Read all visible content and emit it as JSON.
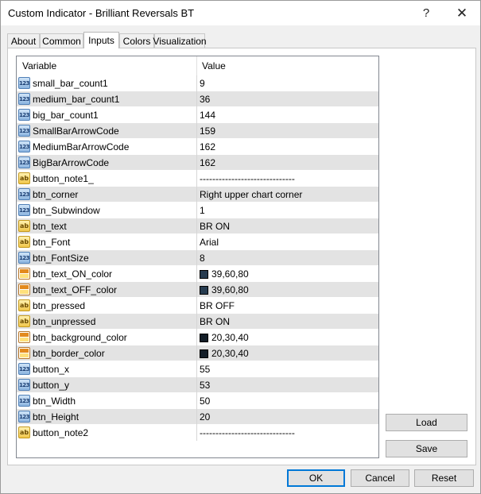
{
  "window": {
    "title": "Custom Indicator - Brilliant Reversals BT",
    "help": "?",
    "close": "✕"
  },
  "tabs": [
    {
      "label": "About"
    },
    {
      "label": "Common"
    },
    {
      "label": "Inputs"
    },
    {
      "label": "Colors"
    },
    {
      "label": "Visualization"
    }
  ],
  "active_tab": "Inputs",
  "grid": {
    "headers": {
      "variable": "Variable",
      "value": "Value"
    },
    "type_icon_labels": {
      "int": "123",
      "str": "ab"
    },
    "rows": [
      {
        "name": "small_bar_count1",
        "type": "int",
        "value": "9"
      },
      {
        "name": "medium_bar_count1",
        "type": "int",
        "value": "36"
      },
      {
        "name": "big_bar_count1",
        "type": "int",
        "value": "144"
      },
      {
        "name": "SmallBarArrowCode",
        "type": "int",
        "value": "159"
      },
      {
        "name": "MediumBarArrowCode",
        "type": "int",
        "value": "162"
      },
      {
        "name": "BigBarArrowCode",
        "type": "int",
        "value": "162"
      },
      {
        "name": "button_note1_",
        "type": "str",
        "value": "------------------------------"
      },
      {
        "name": "btn_corner",
        "type": "int",
        "value": "Right upper chart corner"
      },
      {
        "name": "btn_Subwindow",
        "type": "int",
        "value": "1"
      },
      {
        "name": "btn_text",
        "type": "str",
        "value": "BR ON"
      },
      {
        "name": "btn_Font",
        "type": "str",
        "value": "Arial"
      },
      {
        "name": "btn_FontSize",
        "type": "int",
        "value": "8"
      },
      {
        "name": "btn_text_ON_color",
        "type": "color",
        "value": "39,60,80",
        "swatch": "#273c50"
      },
      {
        "name": "btn_text_OFF_color",
        "type": "color",
        "value": "39,60,80",
        "swatch": "#273c50"
      },
      {
        "name": "btn_pressed",
        "type": "str",
        "value": "BR OFF"
      },
      {
        "name": "btn_unpressed",
        "type": "str",
        "value": "BR ON"
      },
      {
        "name": "btn_background_color",
        "type": "color",
        "value": "20,30,40",
        "swatch": "#141e28"
      },
      {
        "name": "btn_border_color",
        "type": "color",
        "value": "20,30,40",
        "swatch": "#141e28"
      },
      {
        "name": "button_x",
        "type": "int",
        "value": "55"
      },
      {
        "name": "button_y",
        "type": "int",
        "value": "53"
      },
      {
        "name": "btn_Width",
        "type": "int",
        "value": "50"
      },
      {
        "name": "btn_Height",
        "type": "int",
        "value": "20"
      },
      {
        "name": "button_note2",
        "type": "str",
        "value": "------------------------------"
      }
    ]
  },
  "buttons": {
    "load": "Load",
    "save": "Save",
    "ok": "OK",
    "cancel": "Cancel",
    "reset": "Reset"
  },
  "colors": {
    "accent": "#0078d7",
    "row_alt": "#e3e3e3"
  }
}
